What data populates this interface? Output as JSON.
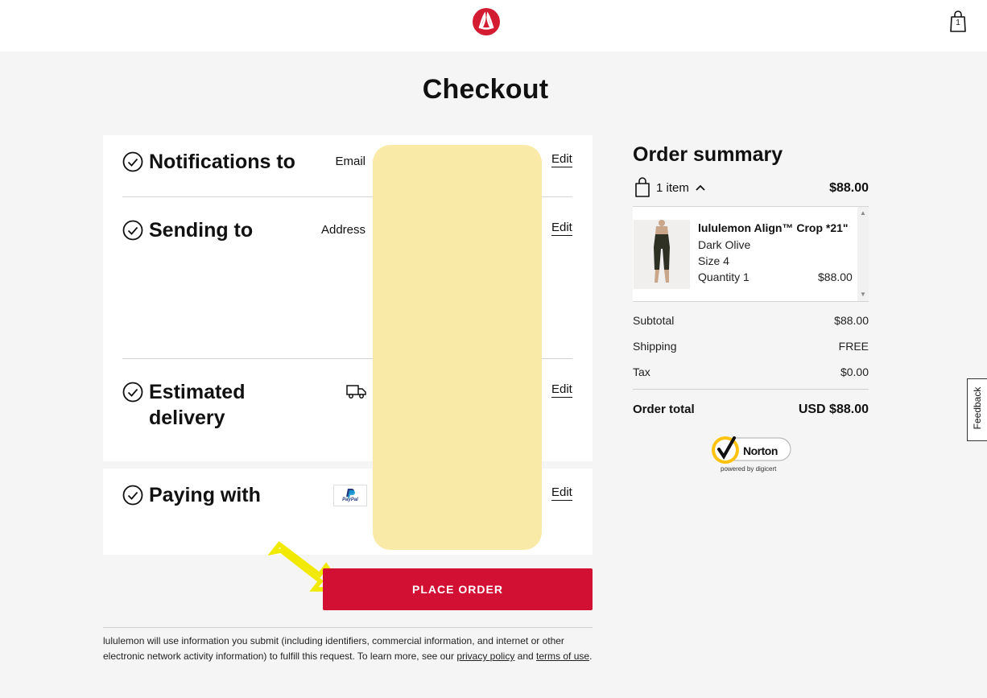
{
  "header": {
    "bag_count": "1"
  },
  "page_title": "Checkout",
  "sections": {
    "notifications": {
      "title": "Notifications to",
      "label": "Email",
      "edit": "Edit"
    },
    "sending": {
      "title": "Sending to",
      "label": "Address",
      "edit": "Edit"
    },
    "delivery": {
      "title_line1": "Estimated",
      "title_line2": "delivery",
      "edit": "Edit"
    },
    "paying": {
      "title": "Paying with",
      "edit": "Edit",
      "payment_brand": "PayPal"
    }
  },
  "place_order_label": "PLACE ORDER",
  "disclaimer": {
    "text_before": "lululemon will use information you submit (including identifiers, commercial information, and internet or other electronic network activity information) to fulfill this request. To learn more, see our ",
    "privacy_link": "privacy policy",
    "and": " and ",
    "terms_link": "terms of use",
    "end": "."
  },
  "order_summary": {
    "title": "Order summary",
    "items_label": "1 item",
    "items_total": "$88.00",
    "product": {
      "name": "lululemon Align™ Crop *21\"",
      "color": "Dark Olive",
      "size": "Size 4",
      "quantity": "Quantity 1",
      "price": "$88.00"
    },
    "subtotal_label": "Subtotal",
    "subtotal_value": "$88.00",
    "shipping_label": "Shipping",
    "shipping_value": "FREE",
    "tax_label": "Tax",
    "tax_value": "$0.00",
    "total_label": "Order total",
    "total_value": "USD $88.00"
  },
  "norton": {
    "name": "Norton",
    "powered_by": "powered by digicert"
  },
  "feedback_label": "Feedback",
  "colors": {
    "brand_red": "#d21033",
    "logo_red": "#d31c32",
    "highlight_yellow": "#f2e900",
    "redaction": "#faeaa7"
  }
}
